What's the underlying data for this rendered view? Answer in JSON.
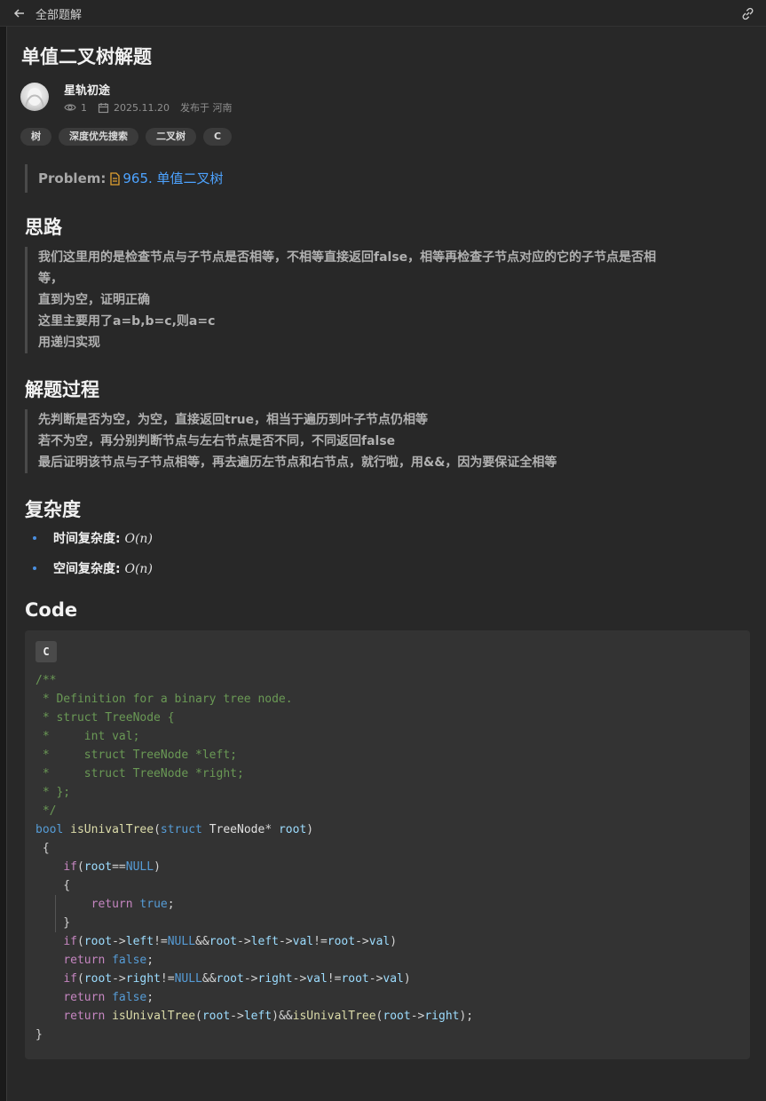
{
  "topbar": {
    "title": "全部题解"
  },
  "post": {
    "title": "单值二叉树解题",
    "author": "星轨初途",
    "views": "1",
    "date": "2025.11.20",
    "location": "发布于 河南",
    "tags": [
      "树",
      "深度优先搜索",
      "二叉树",
      "C"
    ]
  },
  "problem": {
    "label": "Problem:",
    "link": "965. 单值二叉树"
  },
  "sections": {
    "idea": {
      "heading": "思路",
      "lines": [
        "我们这里用的是检查节点与子节点是否相等，不相等直接返回false，相等再检查子节点对应的它的子节点是否相",
        "等，",
        "直到为空，证明正确",
        "这里主要用了a=b,b=c,则a=c",
        "用递归实现"
      ]
    },
    "process": {
      "heading": "解题过程",
      "lines": [
        "先判断是否为空，为空，直接返回true，相当于遍历到叶子节点仍相等",
        "若不为空，再分别判断节点与左右节点是否不同，不同返回false",
        "最后证明该节点与子节点相等，再去遍历左节点和右节点，就行啦，用&&，因为要保证全相等"
      ]
    },
    "complexity": {
      "heading": "复杂度",
      "time_label": "时间复杂度:",
      "time_value": "O(n)",
      "space_label": "空间复杂度:",
      "space_value": "O(n)"
    },
    "code": {
      "heading": "Code",
      "lang": "C"
    }
  },
  "colors": {
    "accent": "#4da3ff",
    "comment": "#6a9955",
    "keyword": "#569cd6",
    "control": "#c586c0",
    "function": "#dcdcaa",
    "variable": "#9cdcfe"
  }
}
